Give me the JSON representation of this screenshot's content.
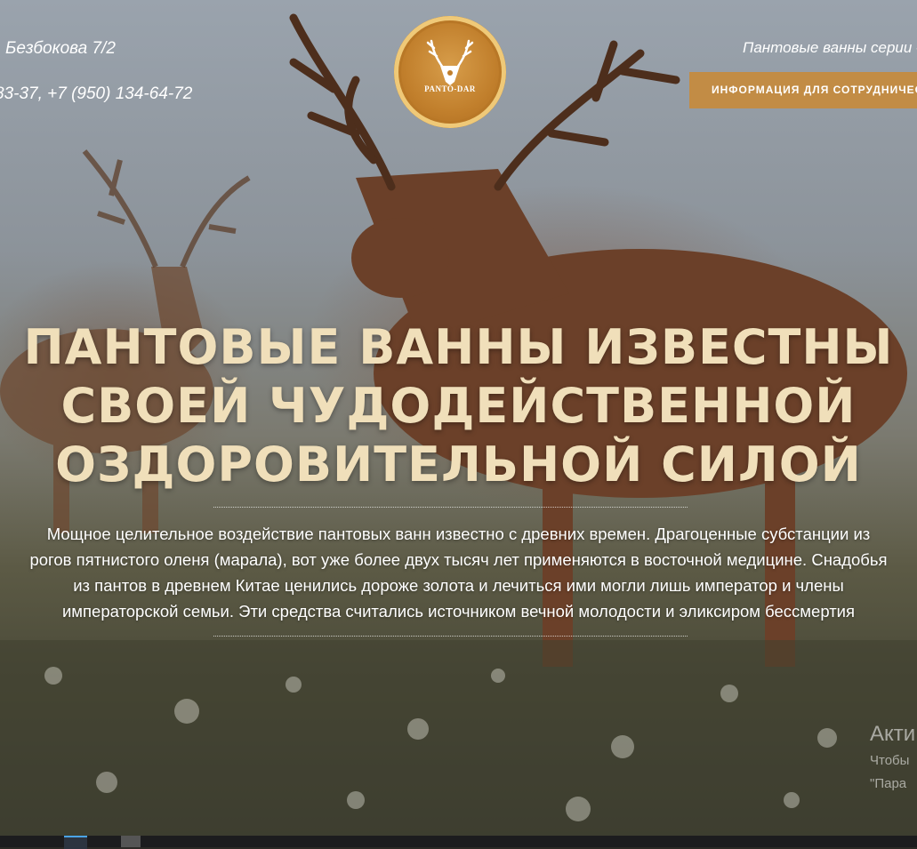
{
  "header": {
    "address": "Безбокова 7/2",
    "phones": "83-37, +7 (950) 134-64-72",
    "logo_text": "PANTO-DAR",
    "series_text": "Пантовые ванны серии «",
    "staff_button": "ИНФОРМАЦИЯ ДЛЯ СОТРУДНИЧЕСТВА"
  },
  "hero": {
    "headline_lines": [
      "ПАНТОВЫЕ ВАННЫ ИЗВЕСТНЫ",
      "СВОЕЙ ЧУДОДЕЙСТВЕННОЙ",
      "ОЗДОРОВИТЕЛЬНОЙ СИЛОЙ"
    ],
    "body_lines": [
      "Мощное целительное воздействие пантовых ванн известно с древних времен. Драгоценные субстанции из",
      "рогов пятнистого оленя (марала), вот уже более двух тысяч лет применяются в восточной медицине. Снадобья",
      "из пантов в древнем Китае ценились дороже золота и лечиться ими могли лишь император и члены",
      "императорской семьи. Эти средства считались источником вечной молодости и эликсиром бессмертия"
    ]
  },
  "windows_watermark": {
    "title": "Акти",
    "line1": "Чтобы",
    "line2": "\"Пара"
  },
  "colors": {
    "accent": "#c28c45",
    "headline": "#f0dfba",
    "logo_gold": "#c17f2c"
  }
}
